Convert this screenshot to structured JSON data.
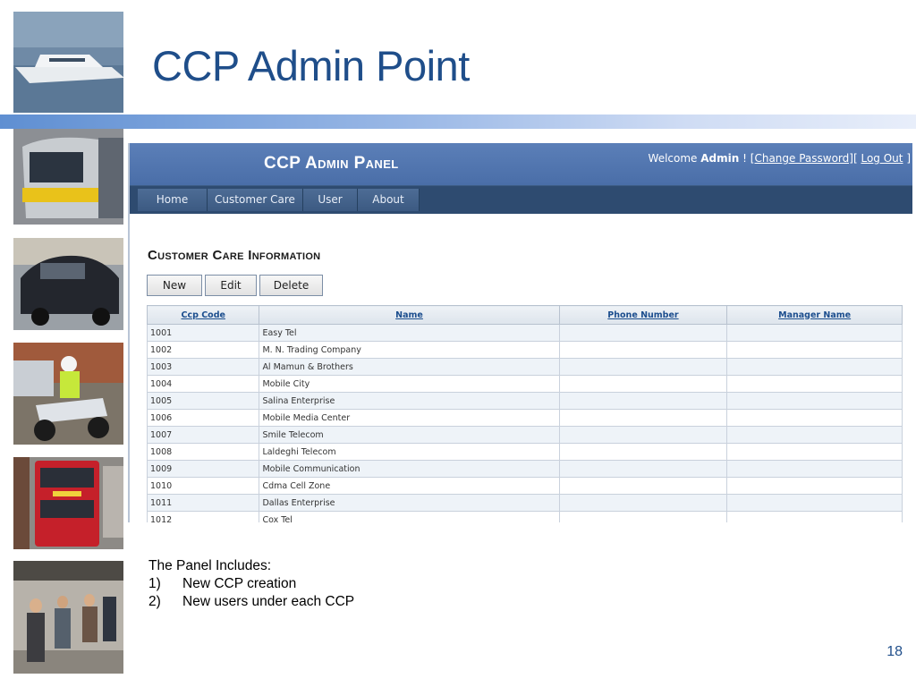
{
  "slide": {
    "title": "CCP Admin Point",
    "page_number": "18",
    "accent_color": "#1f4e8a"
  },
  "panel": {
    "title": "CCP Admin Panel",
    "welcome_prefix": "Welcome",
    "user": "Admin",
    "welcome_suffix": "!",
    "change_password": "[Change Password]",
    "bracket": "[",
    "logout": "Log Out",
    "close_bracket": "]",
    "nav": [
      "Home",
      "Customer Care",
      "User",
      "About"
    ],
    "section_title": "Customer Care Information",
    "buttons": {
      "new": "New",
      "edit": "Edit",
      "delete": "Delete"
    },
    "table": {
      "headers": [
        "Ccp Code",
        "Name",
        "Phone Number",
        "Manager Name"
      ],
      "rows": [
        [
          "1001",
          "Easy Tel",
          "",
          ""
        ],
        [
          "1002",
          "M. N. Trading Company",
          "",
          ""
        ],
        [
          "1003",
          "Al Mamun & Brothers",
          "",
          ""
        ],
        [
          "1004",
          "Mobile City",
          "",
          ""
        ],
        [
          "1005",
          "Salina Enterprise",
          "",
          ""
        ],
        [
          "1006",
          "Mobile Media Center",
          "",
          ""
        ],
        [
          "1007",
          "Smile Telecom",
          "",
          ""
        ],
        [
          "1008",
          "Laldeghi Telecom",
          "",
          ""
        ],
        [
          "1009",
          "Mobile Communication",
          "",
          ""
        ],
        [
          "1010",
          "Cdma Cell Zone",
          "",
          ""
        ],
        [
          "1011",
          "Dallas Enterprise",
          "",
          ""
        ],
        [
          "1012",
          "Cox Tel",
          "",
          ""
        ]
      ]
    }
  },
  "includes": {
    "heading": "The Panel Includes:",
    "items": [
      {
        "num": "1)",
        "text": "New CCP creation"
      },
      {
        "num": "2)",
        "text": "New users under  each CCP"
      }
    ]
  }
}
